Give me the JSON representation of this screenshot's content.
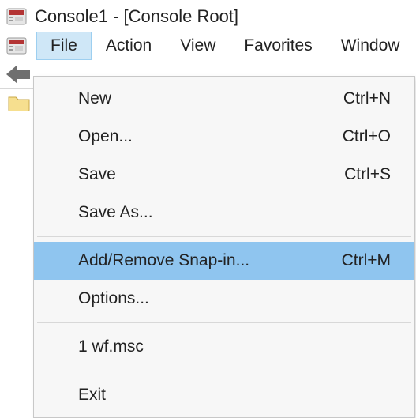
{
  "window_title": "Console1 - [Console Root]",
  "menubar": {
    "items": [
      {
        "label": "File",
        "active": true
      },
      {
        "label": "Action",
        "active": false
      },
      {
        "label": "View",
        "active": false
      },
      {
        "label": "Favorites",
        "active": false
      },
      {
        "label": "Window",
        "active": false
      }
    ]
  },
  "dropdown": {
    "groups": [
      [
        {
          "label": "New",
          "shortcut": "Ctrl+N",
          "highlight": false
        },
        {
          "label": "Open...",
          "shortcut": "Ctrl+O",
          "highlight": false
        },
        {
          "label": "Save",
          "shortcut": "Ctrl+S",
          "highlight": false
        },
        {
          "label": "Save As...",
          "shortcut": "",
          "highlight": false
        }
      ],
      [
        {
          "label": "Add/Remove Snap-in...",
          "shortcut": "Ctrl+M",
          "highlight": true
        },
        {
          "label": "Options...",
          "shortcut": "",
          "highlight": false
        }
      ],
      [
        {
          "label": "1 wf.msc",
          "shortcut": "",
          "highlight": false
        }
      ],
      [
        {
          "label": "Exit",
          "shortcut": "",
          "highlight": false
        }
      ]
    ]
  },
  "icons": {
    "mmc": "mmc-icon",
    "back": "back-arrow-icon",
    "folder": "folder-icon"
  }
}
